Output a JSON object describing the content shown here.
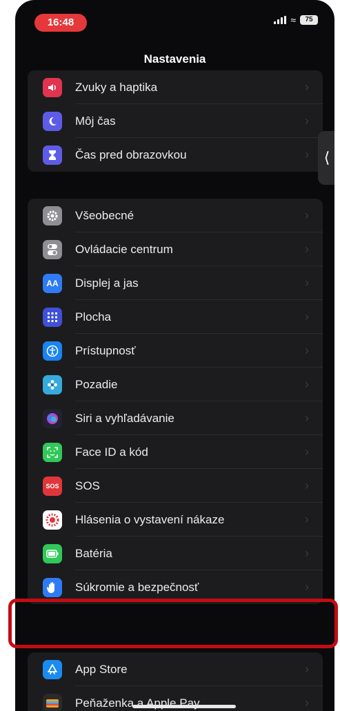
{
  "status_bar": {
    "time": "16:48",
    "battery": "75"
  },
  "nav": {
    "title": "Nastavenia"
  },
  "chevron": "›",
  "groups": [
    {
      "items": [
        {
          "label": "Zvuky a haptika",
          "icon": "speaker-icon",
          "color": "#e0344f"
        },
        {
          "label": "Môj čas",
          "icon": "moon-icon",
          "color": "#5e5ce6"
        },
        {
          "label": "Čas pred obrazovkou",
          "icon": "hourglass-icon",
          "color": "#5e5ce6"
        }
      ]
    },
    {
      "items": [
        {
          "label": "Všeobecné",
          "icon": "gear-icon",
          "color": "#8e8e93"
        },
        {
          "label": "Ovládacie centrum",
          "icon": "toggle-icon",
          "color": "#8e8e93"
        },
        {
          "label": "Displej a jas",
          "icon": "text-size-icon",
          "color": "#2f7bf5",
          "glyph": "AA"
        },
        {
          "label": "Plocha",
          "icon": "grid-icon",
          "color": "#4050d8"
        },
        {
          "label": "Prístupnosť",
          "icon": "accessibility-icon",
          "color": "#1a84f0"
        },
        {
          "label": "Pozadie",
          "icon": "flower-icon",
          "color": "#35aadc"
        },
        {
          "label": "Siri a vyhľadávanie",
          "icon": "siri-icon",
          "color": "#222233"
        },
        {
          "label": "Face ID a kód",
          "icon": "face-id-icon",
          "color": "#30c859"
        },
        {
          "label": "SOS",
          "icon": "sos-icon",
          "color": "#e0363a",
          "glyph": "SOS"
        },
        {
          "label": "Hlásenia o vystavení nákaze",
          "icon": "exposure-icon",
          "color": "#ffffff"
        },
        {
          "label": "Batéria",
          "icon": "battery-icon",
          "color": "#30c859"
        },
        {
          "label": "Súkromie a bezpečnosť",
          "icon": "hand-icon",
          "color": "#2f7bf5"
        }
      ]
    },
    {
      "items": [
        {
          "label": "App Store",
          "icon": "app-store-icon",
          "color": "#1a8cf0"
        },
        {
          "label": "Peňaženka a Apple Pay",
          "icon": "wallet-icon",
          "color": "#2a2a2a"
        }
      ]
    }
  ]
}
